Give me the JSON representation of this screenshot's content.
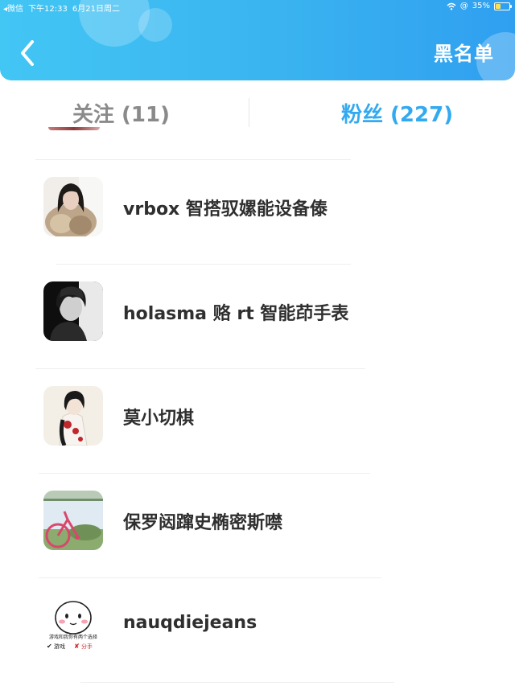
{
  "status_bar": {
    "carrier": "◂微信",
    "time": "下午12:33",
    "date": "6月21日周二",
    "battery": "35%",
    "battery_level": 0.35
  },
  "header": {
    "back_icon": "chevron-left-icon",
    "right_button": "黑名单"
  },
  "tabs": [
    {
      "label": "关注 (11)",
      "selected": false
    },
    {
      "label": "粉丝 (227)",
      "selected": true
    }
  ],
  "colors": {
    "header_gradient_start": "#42c6f4",
    "header_gradient_end": "#2f9ff0",
    "active_tab": "#33aaf0",
    "inactive_tab": "#8a8a8a",
    "username_text": "#2f2f2f"
  },
  "fans": [
    {
      "username": "vrbox 智搭驭嫘能设备傣",
      "avatar": "woman-in-fur-coat-photo"
    },
    {
      "username": "holasma 赂 rt 智能茚手表",
      "avatar": "black-and-white-portrait-photo"
    },
    {
      "username": "莫小切棋",
      "avatar": "anime-girl-illustration"
    },
    {
      "username": "保罗闼蹿史椭密斯噤",
      "avatar": "pink-bicycle-photo"
    },
    {
      "username": "nauqdiejeans",
      "avatar": "cartoon-face-sticker",
      "avatar_caption": "游戏和我你有两个选择",
      "avatar_option_game": "游戏",
      "avatar_option_breakup": "分手"
    }
  ]
}
